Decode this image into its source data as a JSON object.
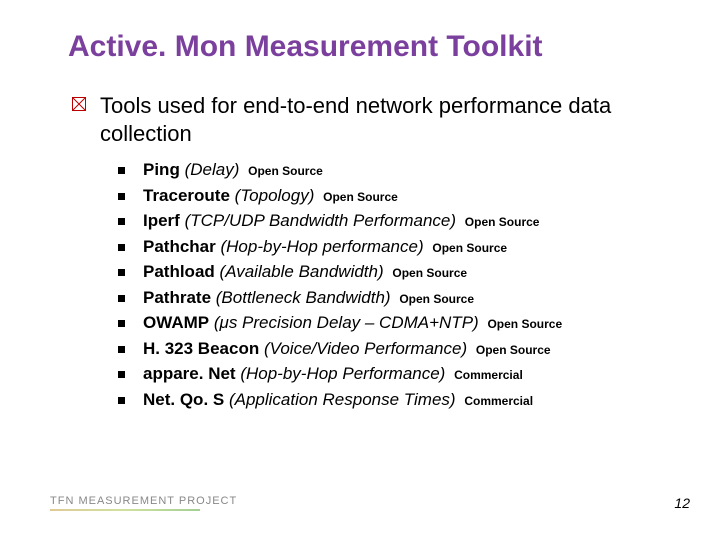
{
  "title": "Active. Mon Measurement Toolkit",
  "intro": "Tools used for end-to-end network performance data collection",
  "tools": [
    {
      "name": "Ping",
      "desc": "(Delay)",
      "tag": "Open Source"
    },
    {
      "name": "Traceroute",
      "desc": "(Topology)",
      "tag": "Open Source"
    },
    {
      "name": "Iperf",
      "desc": "(TCP/UDP Bandwidth Performance)",
      "tag": "Open Source"
    },
    {
      "name": "Pathchar",
      "desc": "(Hop-by-Hop performance)",
      "tag": "Open Source"
    },
    {
      "name": "Pathload",
      "desc": "(Available Bandwidth)",
      "tag": "Open Source"
    },
    {
      "name": "Pathrate",
      "desc": "(Bottleneck Bandwidth)",
      "tag": "Open Source"
    },
    {
      "name": "OWAMP",
      "desc": "(μs Precision Delay – CDMA+NTP)",
      "tag": "Open Source"
    },
    {
      "name": "H. 323 Beacon",
      "desc": "(Voice/Video Performance)",
      "tag": "Open Source"
    },
    {
      "name": "appare. Net",
      "desc": "(Hop-by-Hop Performance)",
      "tag": "Commercial"
    },
    {
      "name": "Net. Qo. S",
      "desc": "(Application Response Times)",
      "tag": "Commercial"
    }
  ],
  "footer": {
    "logo_text": "TFN MEASUREMENT PROJECT",
    "page_number": "12"
  }
}
